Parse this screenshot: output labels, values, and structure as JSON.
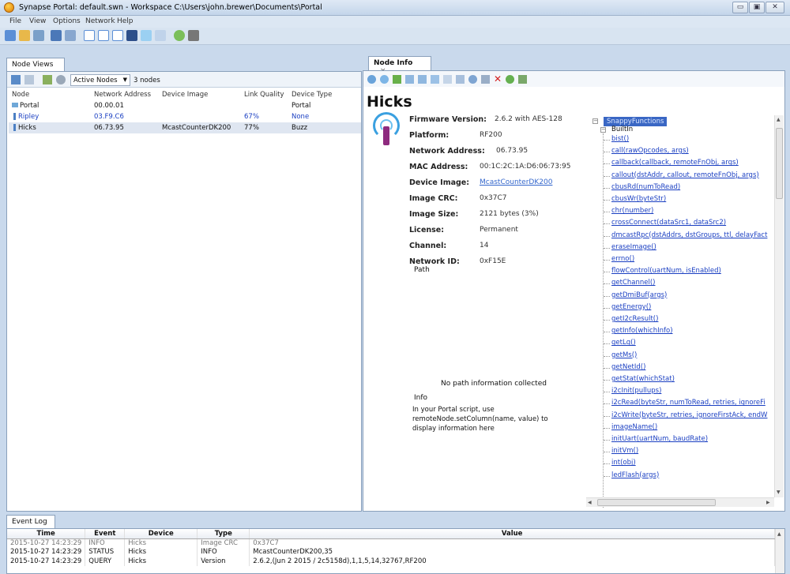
{
  "window": {
    "title": "Synapse Portal: default.swn - Workspace C:\\Users\\john.brewer\\Documents\\Portal",
    "controls": [
      "▭",
      "▣",
      "✕"
    ]
  },
  "menu": [
    "File",
    "View",
    "Options",
    "Network",
    "Help"
  ],
  "node_views": {
    "tab": "Node Views",
    "filter": "Active Nodes",
    "count": "3 nodes",
    "columns": [
      "Node",
      "Network Address",
      "Device Image",
      "Link Quality",
      "Device Type"
    ],
    "rows": [
      {
        "node": "Portal",
        "addr": "00.00.01",
        "image": "",
        "lq": "",
        "type": "Portal"
      },
      {
        "node": "Ripley",
        "addr": "03.F9.C6",
        "image": "",
        "lq": "67%",
        "type": "None"
      },
      {
        "node": "Hicks",
        "addr": "06.73.95",
        "image": "McastCounterDK200",
        "lq": "77%",
        "type": "Buzz"
      }
    ]
  },
  "node_info": {
    "tab": "Node Info",
    "tab_close": "×",
    "name": "Hicks",
    "fields": [
      {
        "label": "Firmware Version:",
        "value": "2.6.2 with AES-128"
      },
      {
        "label": "Platform:",
        "value": "RF200"
      },
      {
        "label": "Network Address:",
        "value": "06.73.95"
      },
      {
        "label": "MAC Address:",
        "value": "00:1C:2C:1A:D6:06:73:95"
      },
      {
        "label": "Device Image:",
        "value": "McastCounterDK200"
      },
      {
        "label": "Image CRC:",
        "value": "0x37C7"
      },
      {
        "label": "Image Size:",
        "value": "2121 bytes (3%)"
      },
      {
        "label": "License:",
        "value": "Permanent"
      },
      {
        "label": "Channel:",
        "value": "14"
      },
      {
        "label": "Network ID:",
        "value": "0xF15E"
      }
    ],
    "path_label": "Path",
    "path_message": "No path information collected",
    "info_label": "Info",
    "info_text": "In your Portal script, use remoteNode.setColumn(name, value) to display information here"
  },
  "tree": {
    "root": "SnappyFunctions",
    "group": "BuiltIn",
    "items": [
      "bist()",
      "call(rawOpcodes, args)",
      "callback(callback, remoteFnObj, args)",
      "callout(dstAddr, callout, remoteFnObj, args)",
      "cbusRd(numToRead)",
      "cbusWr(byteStr)",
      "chr(number)",
      "crossConnect(dataSrc1, dataSrc2)",
      "dmcastRpc(dstAddrs, dstGroups, ttl, delayFact",
      "eraseImage()",
      "errno()",
      "flowControl(uartNum, isEnabled)",
      "getChannel()",
      "getDmiBuf(args)",
      "getEnergy()",
      "getI2cResult()",
      "getInfo(whichInfo)",
      "getLq()",
      "getMs()",
      "getNetId()",
      "getStat(whichStat)",
      "i2cInit(pullups)",
      "i2cRead(byteStr, numToRead, retries, ignoreFi",
      "i2cWrite(byteStr, retries, ignoreFirstAck, endW",
      "imageName()",
      "initUart(uartNum, baudRate)",
      "initVm()",
      "int(obj)",
      "ledFlash(args)"
    ]
  },
  "event_log": {
    "tab": "Event Log",
    "columns": [
      "Time",
      "Event",
      "Device",
      "Type",
      "Value"
    ],
    "rows": [
      {
        "time": "2015-10-27 14:23:29",
        "event": "INFO",
        "device": "Hicks",
        "type": "Image CRC",
        "value": "0x37C7"
      },
      {
        "time": "2015-10-27 14:23:29",
        "event": "STATUS",
        "device": "Hicks",
        "type": "INFO",
        "value": "McastCounterDK200,35"
      },
      {
        "time": "2015-10-27 14:23:29",
        "event": "QUERY",
        "device": "Hicks",
        "type": "Version",
        "value": "2.6.2,(Jun  2 2015 / 2c5158d),1,1,5,14,32767,RF200"
      }
    ]
  }
}
